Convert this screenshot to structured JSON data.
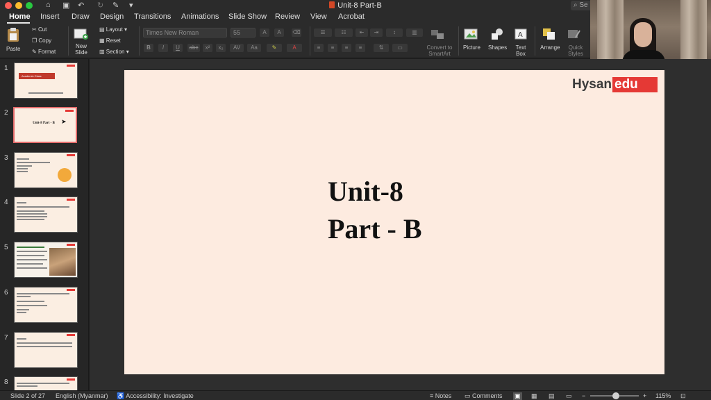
{
  "window": {
    "title": "Unit-8 Part-B",
    "search_placeholder": "Se",
    "close_color": "#ff5f57",
    "minimize_color": "#febc2e",
    "zoom_color": "#28c840"
  },
  "tabs": [
    "Home",
    "Insert",
    "Draw",
    "Design",
    "Transitions",
    "Animations",
    "Slide Show",
    "Review",
    "View",
    "Acrobat"
  ],
  "active_tab": "Home",
  "ribbon": {
    "paste": "Paste",
    "cut": "Cut",
    "copy": "Copy",
    "format": "Format",
    "new_slide": "New Slide",
    "layout": "Layout",
    "reset": "Reset",
    "section": "Section",
    "font_name": "Times New Roman",
    "font_size": "55",
    "convert_smartart": "Convert to SmartArt",
    "picture": "Picture",
    "shapes": "Shapes",
    "text_box": "Text Box",
    "arrange": "Arrange",
    "quick_styles": "Quick Styles",
    "style_buttons": [
      "B",
      "I",
      "U",
      "abc",
      "x²",
      "x₂",
      "AV",
      "Aa"
    ]
  },
  "slides_panel": {
    "thumbnails": [
      {
        "number": "1",
        "label": "Academic Class"
      },
      {
        "number": "2",
        "label": "Unit-8 Part - B"
      },
      {
        "number": "3",
        "label": ""
      },
      {
        "number": "4",
        "label": ""
      },
      {
        "number": "5",
        "label": ""
      },
      {
        "number": "6",
        "label": ""
      },
      {
        "number": "7",
        "label": ""
      },
      {
        "number": "8",
        "label": ""
      }
    ],
    "selected": 2
  },
  "slide": {
    "logo_left": "Hysan",
    "logo_right": "edu",
    "title_line1": "Unit-8",
    "title_line2": "Part - B",
    "background": "#fdebe0",
    "accent": "#e53935"
  },
  "statusbar": {
    "slide_info": "Slide 2 of 27",
    "language": "English (Myanmar)",
    "accessibility": "Accessibility: Investigate",
    "notes": "Notes",
    "comments": "Comments",
    "zoom": "115%"
  }
}
